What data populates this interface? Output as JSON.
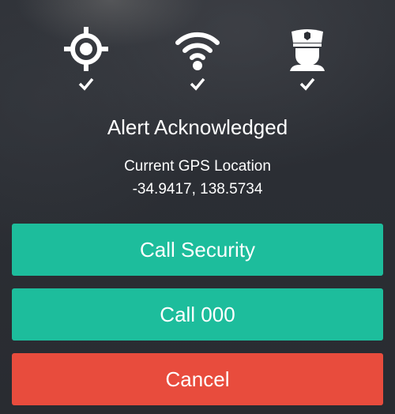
{
  "status_icons": [
    {
      "name": "gps",
      "icon": "gps-crosshair-icon",
      "acknowledged": true
    },
    {
      "name": "wifi",
      "icon": "wifi-icon",
      "acknowledged": true
    },
    {
      "name": "guard",
      "icon": "security-guard-icon",
      "acknowledged": true
    }
  ],
  "alert": {
    "title": "Alert Acknowledged",
    "gps_label": "Current GPS Location",
    "gps_coords": "-34.9417, 138.5734"
  },
  "buttons": {
    "call_security": "Call Security",
    "call_emergency": "Call 000",
    "cancel": "Cancel"
  },
  "colors": {
    "primary": "#1dbd9c",
    "danger": "#e84c3d",
    "background": "#2b2e34",
    "text": "#ffffff"
  }
}
